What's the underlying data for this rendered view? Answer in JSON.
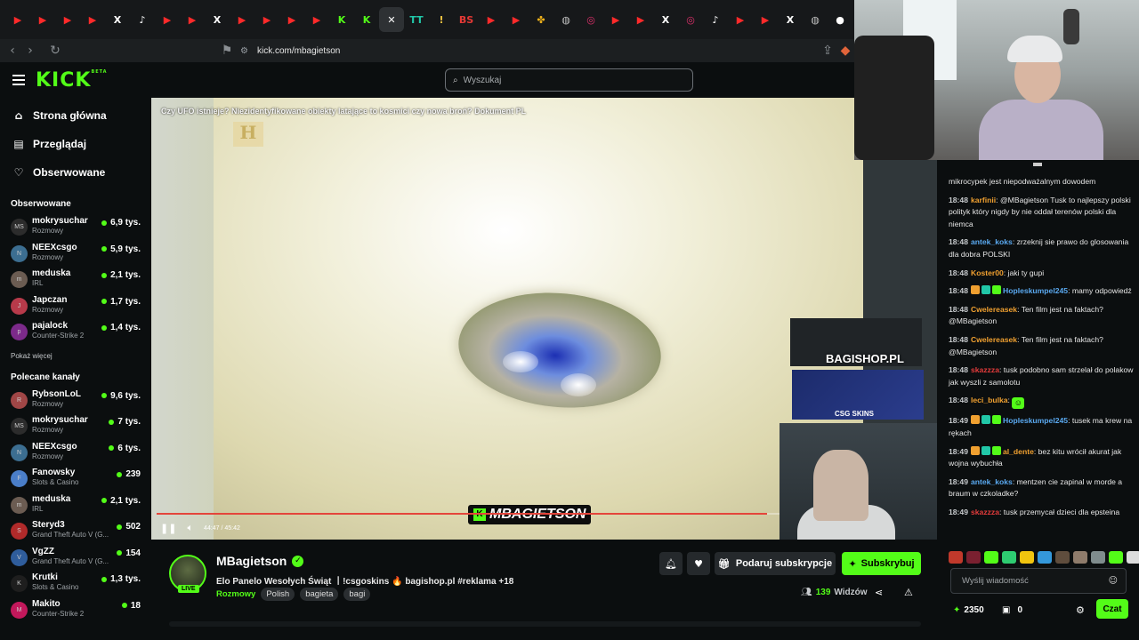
{
  "browser": {
    "tabs": [
      {
        "icon": "youtube-icon",
        "glyph": "▶",
        "color": "#ff2a2a"
      },
      {
        "icon": "youtube-icon",
        "glyph": "▶",
        "color": "#ff2a2a"
      },
      {
        "icon": "youtube-icon",
        "glyph": "▶",
        "color": "#ff2a2a"
      },
      {
        "icon": "youtube-icon",
        "glyph": "▶",
        "color": "#ff2a2a"
      },
      {
        "icon": "x-icon",
        "glyph": "X",
        "color": "#ffffff"
      },
      {
        "icon": "tiktok-icon",
        "glyph": "♪",
        "color": "#ffffff"
      },
      {
        "icon": "youtube-icon",
        "glyph": "▶",
        "color": "#ff2a2a"
      },
      {
        "icon": "youtube-icon",
        "glyph": "▶",
        "color": "#ff2a2a"
      },
      {
        "icon": "x-icon",
        "glyph": "X",
        "color": "#ffffff"
      },
      {
        "icon": "youtube-icon",
        "glyph": "▶",
        "color": "#ff2a2a"
      },
      {
        "icon": "youtube-icon",
        "glyph": "▶",
        "color": "#ff2a2a"
      },
      {
        "icon": "youtube-icon",
        "glyph": "▶",
        "color": "#ff2a2a"
      },
      {
        "icon": "youtube-icon",
        "glyph": "▶",
        "color": "#ff2a2a"
      },
      {
        "icon": "kick-icon",
        "glyph": "K",
        "color": "#53fc18"
      },
      {
        "icon": "kick-icon",
        "glyph": "K",
        "color": "#53fc18"
      },
      {
        "icon": "close-icon",
        "glyph": "✕",
        "color": "#ffffff"
      },
      {
        "icon": "tt-icon",
        "glyph": "TT",
        "color": "#21c7a8"
      },
      {
        "icon": "exclaim-icon",
        "glyph": "!",
        "color": "#f5c542"
      },
      {
        "icon": "bs-icon",
        "glyph": "BS",
        "color": "#e53935"
      },
      {
        "icon": "youtube-icon",
        "glyph": "▶",
        "color": "#ff2a2a"
      },
      {
        "icon": "youtube-icon",
        "glyph": "▶",
        "color": "#ff2a2a"
      },
      {
        "icon": "pinwheel-icon",
        "glyph": "✤",
        "color": "#f0b21a"
      },
      {
        "icon": "globe-icon",
        "glyph": "◍",
        "color": "#c0c0c0"
      },
      {
        "icon": "instagram-icon",
        "glyph": "◎",
        "color": "#e1306c"
      },
      {
        "icon": "youtube-icon",
        "glyph": "▶",
        "color": "#ff2a2a"
      },
      {
        "icon": "youtube-icon",
        "glyph": "▶",
        "color": "#ff2a2a"
      },
      {
        "icon": "x-icon",
        "glyph": "X",
        "color": "#ffffff"
      },
      {
        "icon": "instagram-icon",
        "glyph": "◎",
        "color": "#e1306c"
      },
      {
        "icon": "tiktok-icon",
        "glyph": "♪",
        "color": "#ffffff"
      },
      {
        "icon": "youtube-icon",
        "glyph": "▶",
        "color": "#ff2a2a"
      },
      {
        "icon": "youtube-icon",
        "glyph": "▶",
        "color": "#ff2a2a"
      },
      {
        "icon": "x-icon",
        "glyph": "X",
        "color": "#ffffff"
      },
      {
        "icon": "globe-icon",
        "glyph": "◍",
        "color": "#c0c0c0"
      },
      {
        "icon": "chat-bubble-icon",
        "glyph": "●",
        "color": "#ffffff"
      }
    ],
    "url": "kick.com/mbagietson"
  },
  "header": {
    "logo": "KICK",
    "logo_badge": "BETA",
    "search_placeholder": "Wyszukaj"
  },
  "sidebar": {
    "nav": [
      {
        "icon": "home-icon",
        "glyph": "⌂",
        "label": "Strona główna"
      },
      {
        "icon": "browse-icon",
        "glyph": "▤",
        "label": "Przeglądaj"
      },
      {
        "icon": "heart-icon",
        "glyph": "♡",
        "label": "Obserwowane"
      }
    ],
    "followed_title": "Obserwowane",
    "followed": [
      {
        "name": "mokrysuchar",
        "category": "Rozmowy",
        "viewers": "6,9 tys.",
        "avatar": "MS",
        "color": "#2c2c2c"
      },
      {
        "name": "NEEXcsgo",
        "category": "Rozmowy",
        "viewers": "5,9 tys.",
        "avatar": "N",
        "color": "#3c6e91"
      },
      {
        "name": "meduska",
        "category": "IRL",
        "viewers": "2,1 tys.",
        "avatar": "m",
        "color": "#6b5c52"
      },
      {
        "name": "Japczan",
        "category": "Rozmowy",
        "viewers": "1,7 tys.",
        "avatar": "J",
        "color": "#b73a4a"
      },
      {
        "name": "pajalock",
        "category": "Counter-Strike 2",
        "viewers": "1,4 tys.",
        "avatar": "p",
        "color": "#7c2a8a"
      }
    ],
    "show_more": "Pokaż więcej",
    "recommended_title": "Polecane kanały",
    "recommended": [
      {
        "name": "RybsonLoL",
        "category": "Rozmowy",
        "viewers": "9,6 tys.",
        "avatar": "R",
        "color": "#a04646"
      },
      {
        "name": "mokrysuchar",
        "category": "Rozmowy",
        "viewers": "7 tys.",
        "avatar": "MS",
        "color": "#2c2c2c"
      },
      {
        "name": "NEEXcsgo",
        "category": "Rozmowy",
        "viewers": "6 tys.",
        "avatar": "N",
        "color": "#3c6e91"
      },
      {
        "name": "Fanowsky",
        "category": "Slots & Casino",
        "viewers": "239",
        "avatar": "F",
        "color": "#4a7ec9"
      },
      {
        "name": "meduska",
        "category": "IRL",
        "viewers": "2,1 tys.",
        "avatar": "m",
        "color": "#6b5c52"
      },
      {
        "name": "Steryd3",
        "category": "Grand Theft Auto V (G...",
        "viewers": "502",
        "avatar": "S",
        "color": "#b02a2a"
      },
      {
        "name": "VgZZ",
        "category": "Grand Theft Auto V (G...",
        "viewers": "154",
        "avatar": "V",
        "color": "#2f5d9c"
      },
      {
        "name": "Krutki",
        "category": "Slots & Casino",
        "viewers": "1,3 tys.",
        "avatar": "K",
        "color": "#1e1e1e"
      },
      {
        "name": "Makito",
        "category": "Counter-Strike 2",
        "viewers": "18",
        "avatar": "M",
        "color": "#c2185b"
      }
    ]
  },
  "video": {
    "title": "Czy UFO istnieje? Niezidentyfikowane obiekty latające to kosmici czy nowa broń? Dokument PL",
    "time": "44:47 / 45:42",
    "progress": 0.98,
    "watermark": "MBAGIETSON",
    "merch_text": "BAGISHOP.PL",
    "skins_text": "CSG SKINS"
  },
  "channel": {
    "name": "MBagietson",
    "live": "LIVE",
    "stream_title": "Elo Panelo Wesołych Świąt 丨!csgoskins 🔥 bagishop.pl #reklama +18",
    "category": "Rozmowy",
    "tags": [
      "Polish",
      "bagieta",
      "bagi"
    ],
    "gift_sub": "Podaruj subskrypcje",
    "subscribe": "Subskrybuj",
    "viewers_count": "139",
    "viewers_label": "Widzów"
  },
  "chat": {
    "messages": [
      {
        "time": "",
        "user": "",
        "color": "#ffffff",
        "text": "mikrocypek jest niepodważalnym dowodem"
      },
      {
        "time": "18:48",
        "user": "karfinii",
        "color": "#f0a030",
        "text": "@MBagietson Tusk to najlepszy polski polityk który nigdy by nie oddał terenów polski dla niemca"
      },
      {
        "time": "18:48",
        "user": "antek_koks",
        "color": "#5aa9f0",
        "text": "zrzeknij sie prawo do glosowania dla dobra POLSKI"
      },
      {
        "time": "18:48",
        "user": "Koster00",
        "color": "#f0a030",
        "text": "jaki ty gupi"
      },
      {
        "time": "18:48",
        "user": "Hopleskumpel245",
        "color": "#5aa9f0",
        "text": "mamy odpowiedź"
      },
      {
        "time": "18:48",
        "user": "Cwelereasek",
        "color": "#f0a030",
        "text": "Ten film jest na faktach? @MBagietson"
      },
      {
        "time": "18:48",
        "user": "Cwelereasek",
        "color": "#f0a030",
        "text": "Ten film jest na faktach? @MBagietson"
      },
      {
        "time": "18:48",
        "user": "skazzza",
        "color": "#e23b3b",
        "text": "tusk podobno sam strzelał do polakow jak wyszli z samolotu"
      },
      {
        "time": "18:48",
        "user": "leci_bulka",
        "color": "#f0a030",
        "text": ""
      },
      {
        "time": "18:49",
        "user": "Hopleskumpel245",
        "color": "#5aa9f0",
        "text": "tusek ma krew na rękach"
      },
      {
        "time": "18:49",
        "user": "al_dente",
        "color": "#f0a030",
        "text": "bez kitu wrócił akurat jak wojna wybuchła"
      },
      {
        "time": "18:49",
        "user": "antek_koks",
        "color": "#5aa9f0",
        "text": "mentzen cie zapinal w morde a braum w czkoladke?"
      },
      {
        "time": "18:49",
        "user": "skazzza",
        "color": "#e23b3b",
        "text": "tusk przemycał dzieci dla epsteina"
      }
    ],
    "input_placeholder": "Wyślij wiadomość",
    "points": "2350",
    "gifts": "0",
    "send_label": "Czat"
  },
  "colors": {
    "accent": "#53fc18",
    "bg": "#0b0e0f"
  }
}
